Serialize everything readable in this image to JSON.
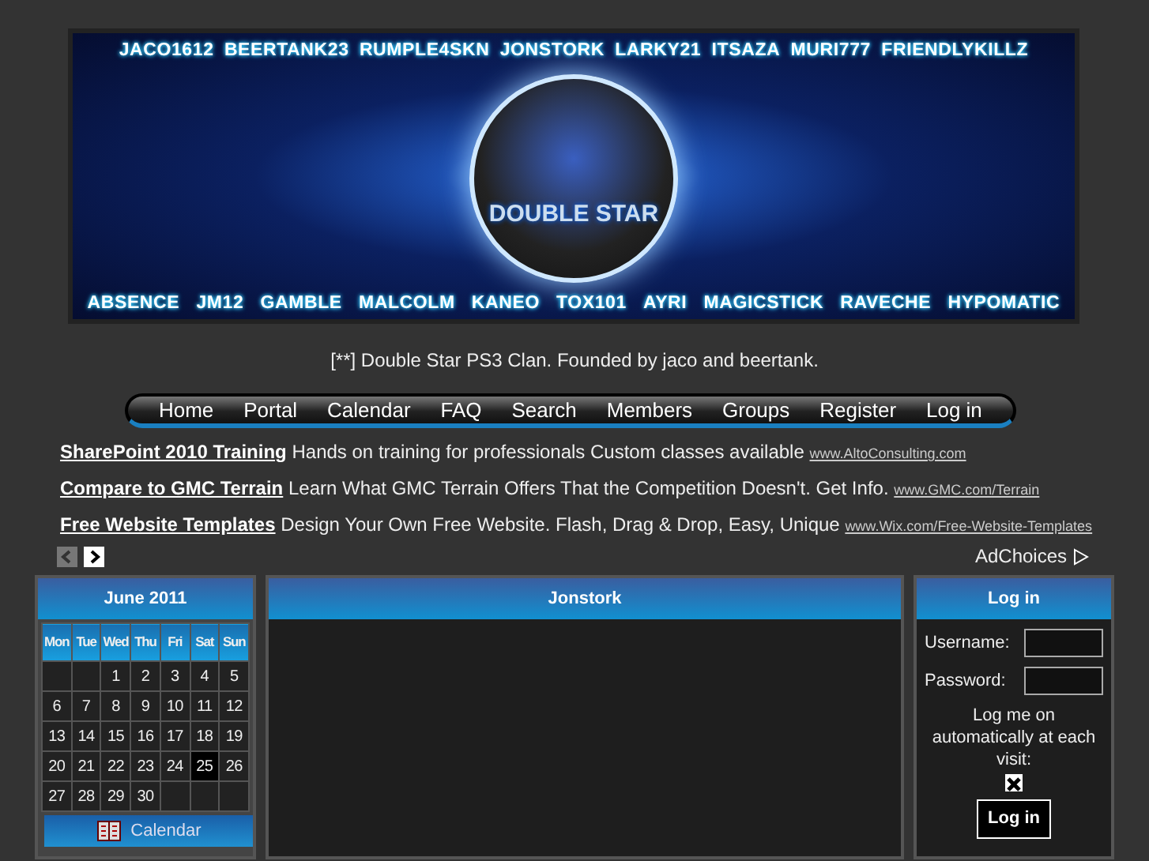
{
  "banner": {
    "names_top": [
      "JACO1612",
      "BEERTANK23",
      "RUMPLE4SKN",
      "JONSTORK",
      "LARKY21",
      "ITSAZA",
      "MURI777",
      "FRIENDLYKILLZ"
    ],
    "names_bottom": [
      "ABSENCE",
      "JM12",
      "GAMBLE",
      "MALCOLM",
      "KANEO",
      "TOX101",
      "AYRI",
      "MAGICSTICK",
      "RAVECHE",
      "HYPOMATIC"
    ],
    "logo_text": "DOUBLE STAR"
  },
  "tagline": "[**] Double Star PS3 Clan. Founded by jaco and beertank.",
  "nav": [
    {
      "label": "Home"
    },
    {
      "label": "Portal"
    },
    {
      "label": "Calendar"
    },
    {
      "label": "FAQ"
    },
    {
      "label": "Search"
    },
    {
      "label": "Members"
    },
    {
      "label": "Groups"
    },
    {
      "label": "Register"
    },
    {
      "label": "Log in"
    }
  ],
  "ads": [
    {
      "title": "SharePoint 2010 Training",
      "text": "Hands on training for professionals Custom classes available",
      "url": "www.AltoConsulting.com"
    },
    {
      "title": "Compare to GMC Terrain",
      "text": "Learn What GMC Terrain Offers That the Competition Doesn't. Get Info.",
      "url": "www.GMC.com/Terrain"
    },
    {
      "title": "Free Website Templates",
      "text": "Design Your Own Free Website. Flash, Drag & Drop, Easy, Unique",
      "url": "www.Wix.com/Free-Website-Templates"
    }
  ],
  "ad_choices": "AdChoices",
  "calendar": {
    "title": "June 2011",
    "weekdays": [
      "Mon",
      "Tue",
      "Wed",
      "Thu",
      "Fri",
      "Sat",
      "Sun"
    ],
    "weeks": [
      [
        {
          "kind": "blank"
        },
        {
          "kind": "blank"
        },
        {
          "kind": "day",
          "label": "1",
          "selected": false
        },
        {
          "kind": "day",
          "label": "2",
          "selected": false
        },
        {
          "kind": "day",
          "label": "3",
          "selected": false
        },
        {
          "kind": "day",
          "label": "4",
          "selected": false
        },
        {
          "kind": "day",
          "label": "5",
          "selected": false
        }
      ],
      [
        {
          "kind": "day",
          "label": "6",
          "selected": false
        },
        {
          "kind": "day",
          "label": "7",
          "selected": false
        },
        {
          "kind": "day",
          "label": "8",
          "selected": false
        },
        {
          "kind": "day",
          "label": "9",
          "selected": false
        },
        {
          "kind": "day",
          "label": "10",
          "selected": false
        },
        {
          "kind": "day",
          "label": "11",
          "selected": false
        },
        {
          "kind": "day",
          "label": "12",
          "selected": false
        }
      ],
      [
        {
          "kind": "day",
          "label": "13",
          "selected": false
        },
        {
          "kind": "day",
          "label": "14",
          "selected": false
        },
        {
          "kind": "day",
          "label": "15",
          "selected": false
        },
        {
          "kind": "day",
          "label": "16",
          "selected": false
        },
        {
          "kind": "day",
          "label": "17",
          "selected": false
        },
        {
          "kind": "day",
          "label": "18",
          "selected": false
        },
        {
          "kind": "day",
          "label": "19",
          "selected": false
        }
      ],
      [
        {
          "kind": "day",
          "label": "20",
          "selected": false
        },
        {
          "kind": "day",
          "label": "21",
          "selected": false
        },
        {
          "kind": "day",
          "label": "22",
          "selected": false
        },
        {
          "kind": "day",
          "label": "23",
          "selected": false
        },
        {
          "kind": "day",
          "label": "24",
          "selected": false
        },
        {
          "kind": "day",
          "label": "25",
          "selected": true
        },
        {
          "kind": "day",
          "label": "26",
          "selected": false
        }
      ],
      [
        {
          "kind": "day",
          "label": "27",
          "selected": false
        },
        {
          "kind": "day",
          "label": "28",
          "selected": false
        },
        {
          "kind": "day",
          "label": "29",
          "selected": false
        },
        {
          "kind": "day",
          "label": "30",
          "selected": false
        },
        {
          "kind": "blank"
        },
        {
          "kind": "blank"
        },
        {
          "kind": "blank"
        }
      ]
    ],
    "button": "Calendar"
  },
  "main_panel": {
    "title": "Jonstork"
  },
  "login": {
    "title": "Log in",
    "username_label": "Username:",
    "password_label": "Password:",
    "remember_label": "Log me on automatically at each visit:",
    "remember_checked": true,
    "button": "Log in"
  }
}
